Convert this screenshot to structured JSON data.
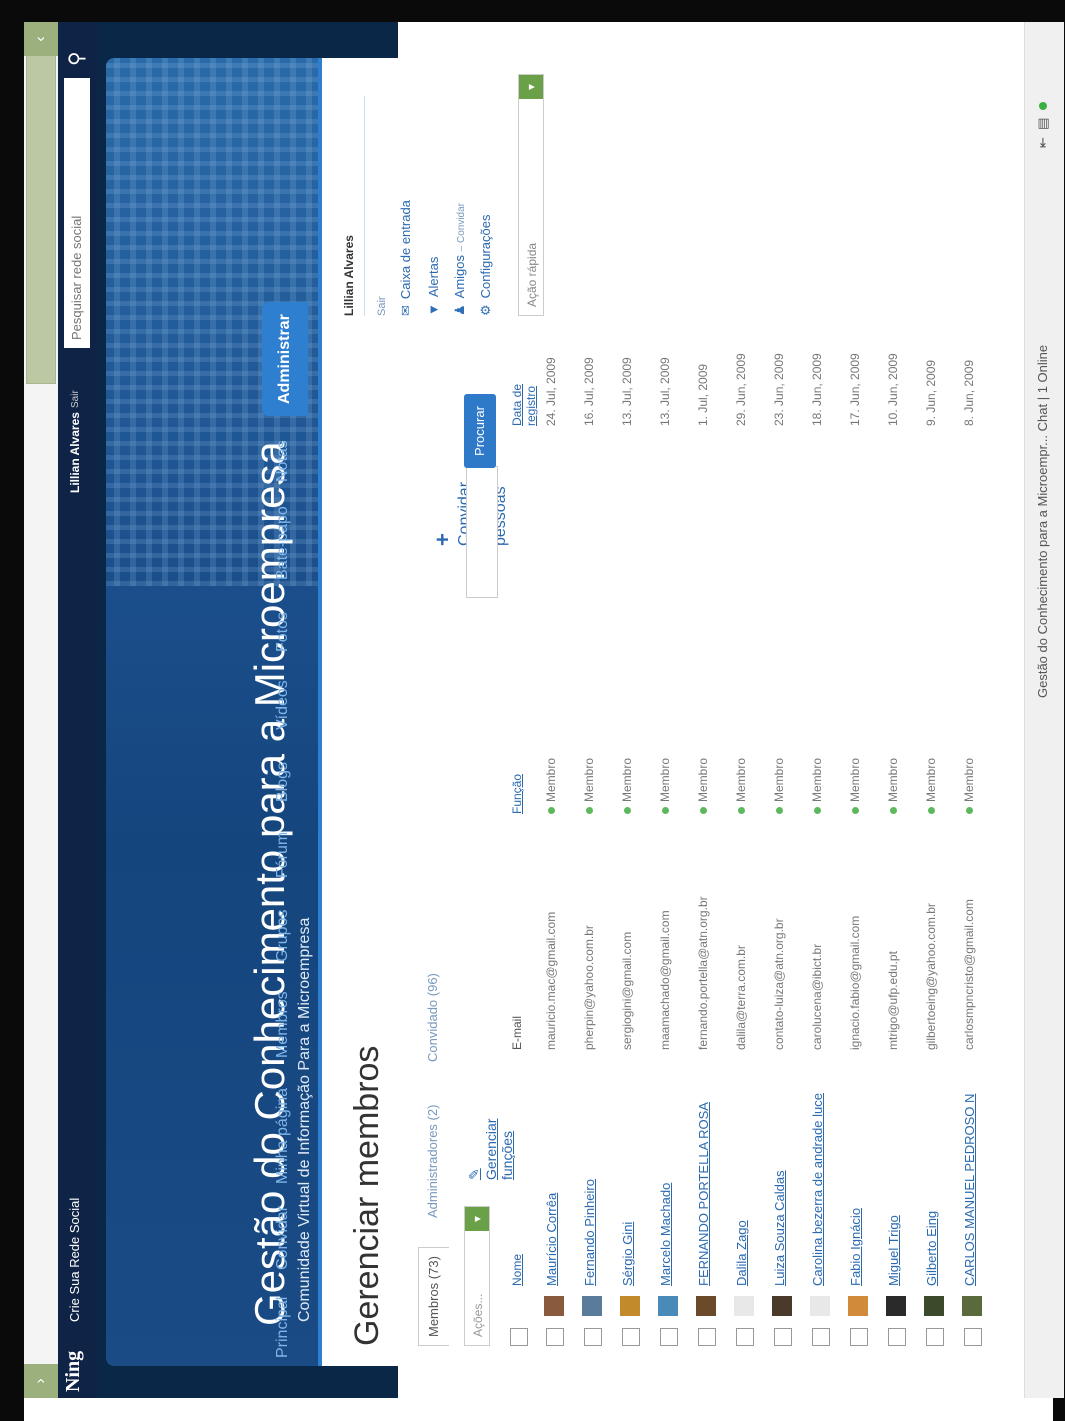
{
  "site": {
    "logo": "Ning",
    "tagline": "Crie Sua Rede Social",
    "user": "Lillian Alvares",
    "sair": "Sair",
    "search_placeholder": "Pesquisar rede social"
  },
  "header": {
    "title": "Gestão do Conhecimento para a Microempresa",
    "subtitle": "Comunidade Virtual de Informação Para a Microempresa"
  },
  "nav": [
    "Principal",
    "Convidar",
    "Minha página",
    "Membros",
    "Grupos",
    "Fórum",
    "Blogs",
    "Vídeos",
    "Fotos",
    "Bate-papo",
    "Notas",
    "Administrar"
  ],
  "page_title": "Gerenciar membros",
  "tabs": [
    "Membros (73)",
    "Administradores (2)",
    "Convidado (96)"
  ],
  "toolbar": {
    "acoes_placeholder": "Ações...",
    "gerenciar_funcoes": "Gerenciar funções",
    "convidar_mais": "Convidar mais pessoas",
    "procurar": "Procurar"
  },
  "columns": {
    "nome": "Nome",
    "email": "E-mail",
    "funcao": "Função",
    "data": "Data de registro"
  },
  "members": [
    {
      "name": "Maurício Corrêa",
      "email": "mauricio.mac@gmail.com",
      "role": "Membro",
      "date": "24. Jul, 2009",
      "avatar_color": "#8a5a3c"
    },
    {
      "name": "Fernando Pinheiro",
      "email": "pherpin@yahoo.com.br",
      "role": "Membro",
      "date": "16. Jul, 2009",
      "avatar_color": "#5b7b9a"
    },
    {
      "name": "Sérgio Gini",
      "email": "sergiogini@gmail.com",
      "role": "Membro",
      "date": "13. Jul, 2009",
      "avatar_color": "#c28a2a"
    },
    {
      "name": "Marcelo Machado",
      "email": "maamachado@gmail.com",
      "role": "Membro",
      "date": "13. Jul, 2009",
      "avatar_color": "#4a8ab8"
    },
    {
      "name": "FERNANDO PORTELLA ROSA",
      "email": "fernando.portella@atn.org.br",
      "role": "Membro",
      "date": "1. Jul, 2009",
      "avatar_color": "#6b4a2a"
    },
    {
      "name": "Dalila Zago",
      "email": "dalila@terra.com.br",
      "role": "Membro",
      "date": "29. Jun, 2009",
      "avatar_color": "#e8e8e8"
    },
    {
      "name": "Luiza Souza Caldas",
      "email": "contato-luiza@atn.org.br",
      "role": "Membro",
      "date": "23. Jun, 2009",
      "avatar_color": "#4a3a2a"
    },
    {
      "name": "Carolina bezerra de andrade luce",
      "email": "carolucena@ibict.br",
      "role": "Membro",
      "date": "18. Jun, 2009",
      "avatar_color": "#e8e8e8"
    },
    {
      "name": "Fabio Ignácio",
      "email": "ignacio.fabio@gmail.com",
      "role": "Membro",
      "date": "17. Jun, 2009",
      "avatar_color": "#d08a3a"
    },
    {
      "name": "Miguel Trigo",
      "email": "mtrigo@ufp.edu.pt",
      "role": "Membro",
      "date": "10. Jun, 2009",
      "avatar_color": "#2a2a2a"
    },
    {
      "name": "Gilberto Eing",
      "email": "gilbertoeing@yahoo.com.br",
      "role": "Membro",
      "date": "9. Jun, 2009",
      "avatar_color": "#3a4a2a"
    },
    {
      "name": "CARLOS MANUEL PEDROSO N",
      "email": "carlosmpncristo@gmail.com",
      "role": "Membro",
      "date": "8. Jun, 2009",
      "avatar_color": "#5a6a3a"
    }
  ],
  "sidebar": {
    "user": "Lillian Alvares",
    "sair": "Sair",
    "links": {
      "inbox": "Caixa de entrada",
      "alerts": "Alertas",
      "friends": "Amigos",
      "friends_invite": "– Convidar",
      "settings": "Configurações"
    },
    "quick_action": "Ação rápida"
  },
  "chat": {
    "label": "Gestão do Conhecimento para a Microempr... Chat",
    "online": "| 1 Online"
  },
  "colors": {
    "accent": "#2f7fd0",
    "header_bg": "#0e2345",
    "link": "#2c6ab0",
    "ok": "#5cb85c"
  }
}
